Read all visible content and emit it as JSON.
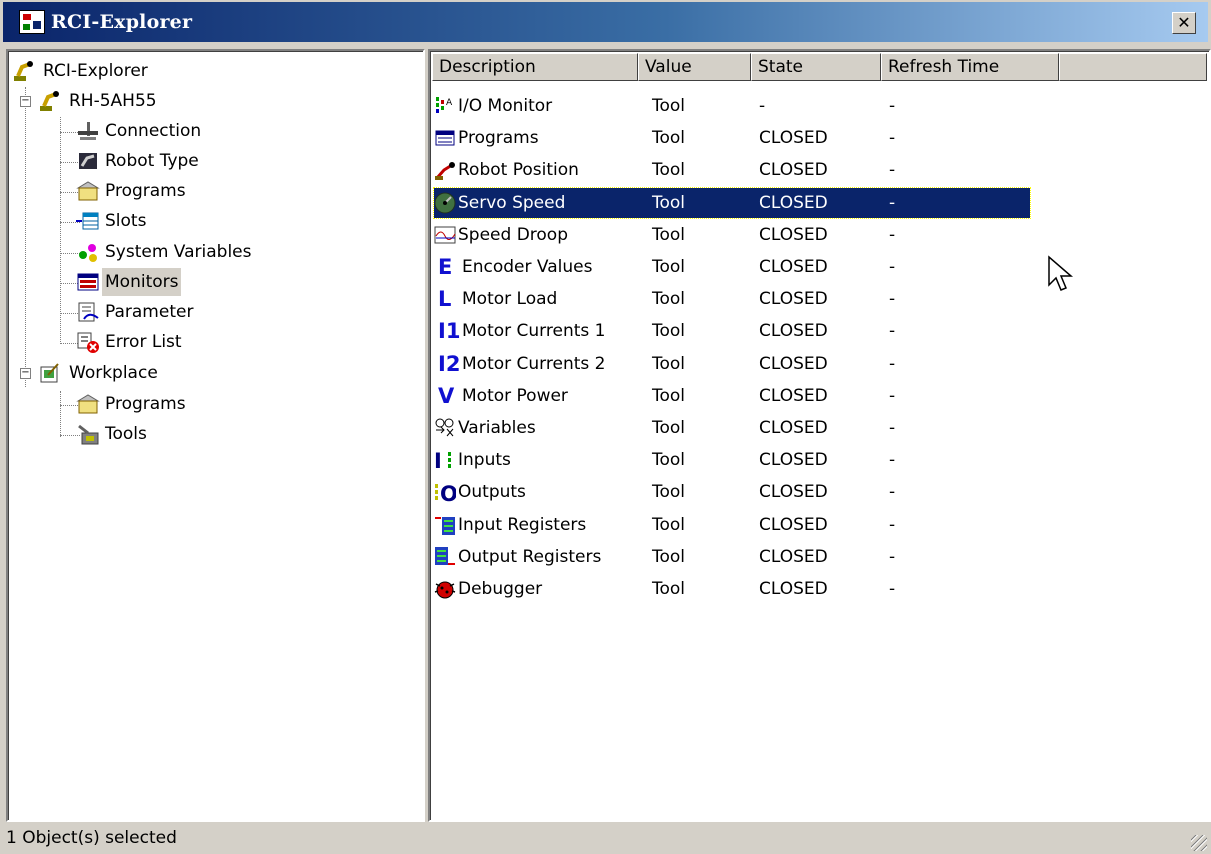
{
  "window": {
    "title": "RCI-Explorer"
  },
  "tree": {
    "root": "RCI-Explorer",
    "robot": "RH-5AH55",
    "robot_children": [
      "Connection",
      "Robot Type",
      "Programs",
      "Slots",
      "System Variables",
      "Monitors",
      "Parameter",
      "Error List"
    ],
    "workplace": "Workplace",
    "workplace_children": [
      "Programs",
      "Tools"
    ],
    "selected": "Monitors"
  },
  "list": {
    "columns": [
      "Description",
      "Value",
      "State",
      "Refresh Time"
    ],
    "rows": [
      {
        "description": "I/O Monitor",
        "value": "Tool",
        "state": "-",
        "refresh": "-",
        "icon": "io-monitor-icon"
      },
      {
        "description": "Programs",
        "value": "Tool",
        "state": "CLOSED",
        "refresh": "-",
        "icon": "programs-icon"
      },
      {
        "description": "Robot Position",
        "value": "Tool",
        "state": "CLOSED",
        "refresh": "-",
        "icon": "robot-position-icon"
      },
      {
        "description": "Servo Speed",
        "value": "Tool",
        "state": "CLOSED",
        "refresh": "-",
        "icon": "gauge-icon"
      },
      {
        "description": "Speed Droop",
        "value": "Tool",
        "state": "CLOSED",
        "refresh": "-",
        "icon": "graph-icon"
      },
      {
        "description": "Encoder Values",
        "value": "Tool",
        "state": "CLOSED",
        "refresh": "-",
        "icon": "letter-e-icon",
        "glyph": "E"
      },
      {
        "description": "Motor Load",
        "value": "Tool",
        "state": "CLOSED",
        "refresh": "-",
        "icon": "letter-l-icon",
        "glyph": "L"
      },
      {
        "description": "Motor Currents 1",
        "value": "Tool",
        "state": "CLOSED",
        "refresh": "-",
        "icon": "i1-icon",
        "glyph": "I1"
      },
      {
        "description": "Motor Currents 2",
        "value": "Tool",
        "state": "CLOSED",
        "refresh": "-",
        "icon": "i2-icon",
        "glyph": "I2"
      },
      {
        "description": "Motor Power",
        "value": "Tool",
        "state": "CLOSED",
        "refresh": "-",
        "icon": "letter-v-icon",
        "glyph": "V"
      },
      {
        "description": "Variables",
        "value": "Tool",
        "state": "CLOSED",
        "refresh": "-",
        "icon": "variables-icon"
      },
      {
        "description": "Inputs",
        "value": "Tool",
        "state": "CLOSED",
        "refresh": "-",
        "icon": "inputs-icon"
      },
      {
        "description": "Outputs",
        "value": "Tool",
        "state": "CLOSED",
        "refresh": "-",
        "icon": "outputs-icon"
      },
      {
        "description": "Input Registers",
        "value": "Tool",
        "state": "CLOSED",
        "refresh": "-",
        "icon": "input-registers-icon"
      },
      {
        "description": "Output Registers",
        "value": "Tool",
        "state": "CLOSED",
        "refresh": "-",
        "icon": "output-registers-icon"
      },
      {
        "description": "Debugger",
        "value": "Tool",
        "state": "CLOSED",
        "refresh": "-",
        "icon": "bug-icon"
      }
    ],
    "selected_row": "Servo Speed"
  },
  "status": {
    "text": "1 Object(s) selected"
  },
  "colors": {
    "titlebar_start": "#0a246a",
    "selection": "#0a246a",
    "window_bg": "#d4d0c8"
  }
}
